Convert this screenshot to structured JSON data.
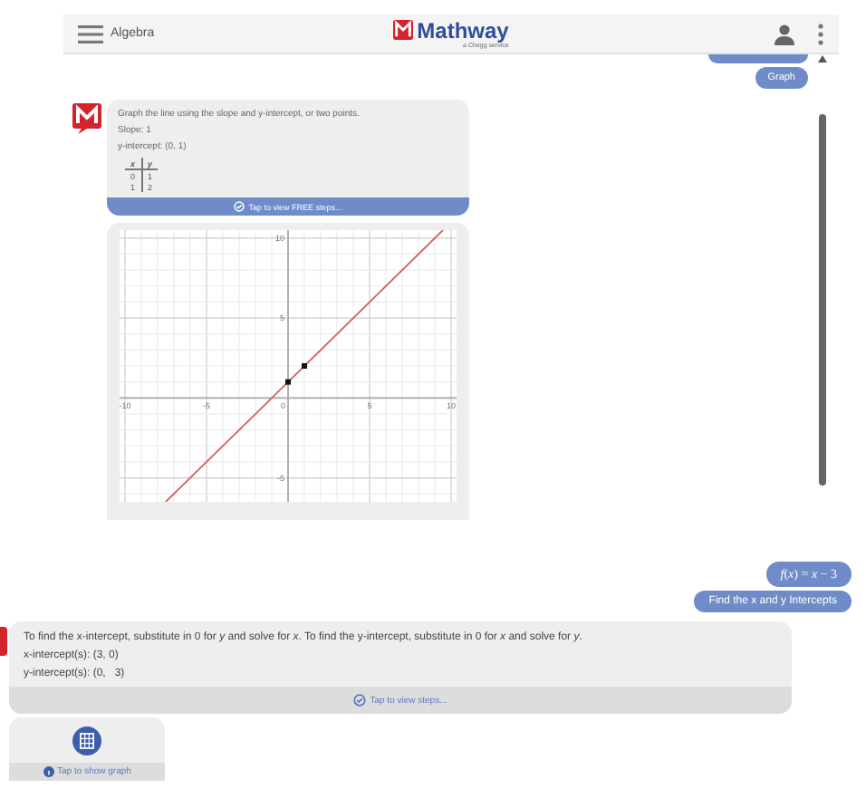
{
  "header": {
    "menu_label": "Algebra",
    "logo": "Mathway",
    "logo_tagline": "a Chegg service"
  },
  "top_chat": {
    "user_message": "Graph",
    "answer": {
      "intro": "Graph the line using the slope and y-intercept, or two points.",
      "lines": [
        "Slope: 1",
        "y-intercept: (0, 1)"
      ],
      "table": {
        "columns": [
          "x",
          "y"
        ],
        "rows": [
          [
            "0",
            "1"
          ],
          [
            "1",
            "2"
          ]
        ]
      },
      "steps_button": "Tap to view FREE steps...",
      "chart_data": {
        "type": "line",
        "x": [
          -7.5,
          9.5
        ],
        "series": [
          {
            "color": "#d0635c",
            "values": [
              -6.5,
              10.5
            ]
          }
        ],
        "xlim": [
          -10,
          10
        ],
        "ylim": [
          -6.5,
          10.5
        ],
        "xticks": [
          -10,
          -5,
          0,
          5,
          10
        ],
        "yticks": [
          -5,
          5,
          10
        ],
        "grid": true
      }
    }
  },
  "bottom_chat": {
    "user_messages": [
      "*f*(*x*) = *x* − 3",
      "Find the x and y Intercepts"
    ],
    "answer": {
      "intro": "To find the x-intercept, substitute in 0 for *y* and solve for *x*. To find the y-intercept, substitute in 0 for *x* and solve for *y*.",
      "lines": [
        "x-intercept(s): (3, 0)",
        "y-intercept(s): (0,   3)"
      ],
      "steps_button": "Tap to view steps..."
    },
    "graph_card": {
      "button": "Tap to show graph"
    }
  }
}
